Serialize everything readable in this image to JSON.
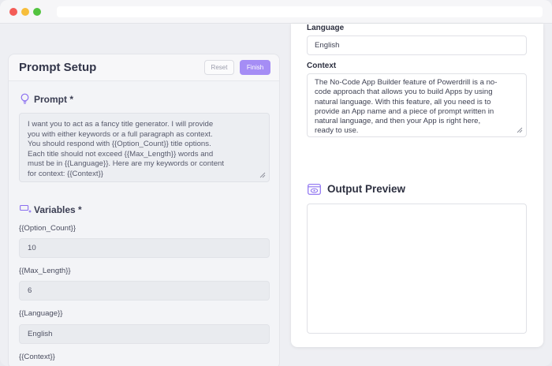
{
  "colors": {
    "accent": "#a58df5",
    "icon": "#8b6ff0"
  },
  "prompt_setup": {
    "title": "Prompt Setup",
    "reset_label": "Reset",
    "finish_label": "Finish",
    "prompt_label": "Prompt *",
    "prompt_text_lines": [
      "I want you to act as a fancy title generator. I will provide",
      "you with either keywords or a full paragraph as context.",
      "You should respond with {{Option_Count}} title options.",
      "Each title should not exceed {{Max_Length}} words and",
      "must be in {{Language}}. Here are my keywords or content",
      "for context: {{Context}}"
    ],
    "variables_label": "Variables *",
    "variables": [
      {
        "name": "{{Option_Count}}",
        "value": "10"
      },
      {
        "name": "{{Max_Length}}",
        "value": "6"
      },
      {
        "name": "{{Language}}",
        "value": "English"
      },
      {
        "name": "{{Context}}",
        "value": ""
      }
    ]
  },
  "preview": {
    "language_label": "Language",
    "language_value": "English",
    "context_label": "Context",
    "context_lines": [
      "The No-Code App Builder feature of Powerdrill is a no-",
      "code approach that allows you to build Apps by using",
      "natural language. With this feature, all you need is to",
      "provide an App name and a piece of prompt written in",
      "natural language, and then your App is right here,",
      "ready to use."
    ],
    "output_title": "Output Preview"
  }
}
